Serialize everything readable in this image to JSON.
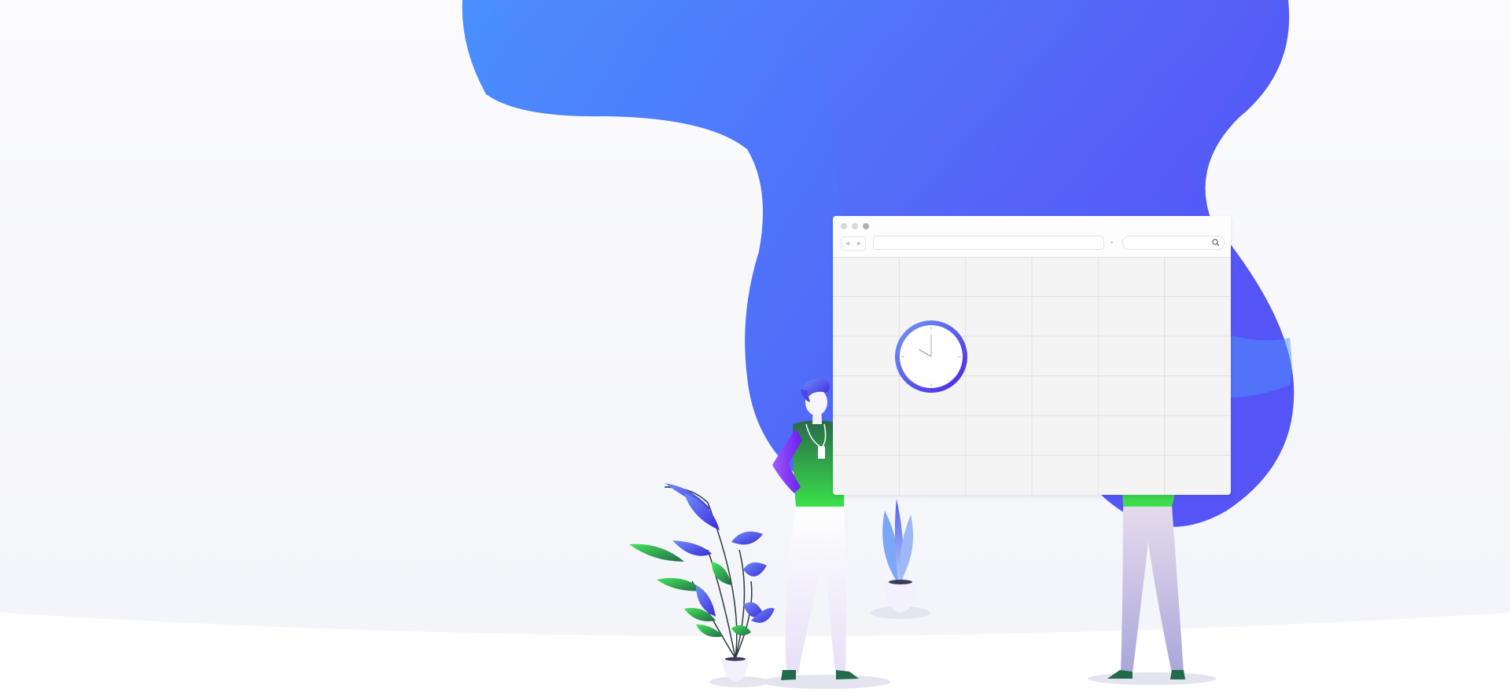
{
  "scene": {
    "description_colors": {
      "blob_start": "#4a8dfd",
      "blob_end": "#5457f7",
      "clock_ring": "#5b49e6",
      "shirt_green": "#39d24b",
      "arm_purple": "#7a2bf6",
      "leaf_green": "#2fbf4f",
      "leaf_blue": "#4d5ef0"
    }
  },
  "browser": {
    "icons": [
      "back-icon",
      "forward-icon",
      "search-icon"
    ],
    "grid": {
      "columns": 6,
      "rows": 6
    }
  },
  "clock": {
    "hour_hand": 10,
    "minute_hand": 0
  }
}
